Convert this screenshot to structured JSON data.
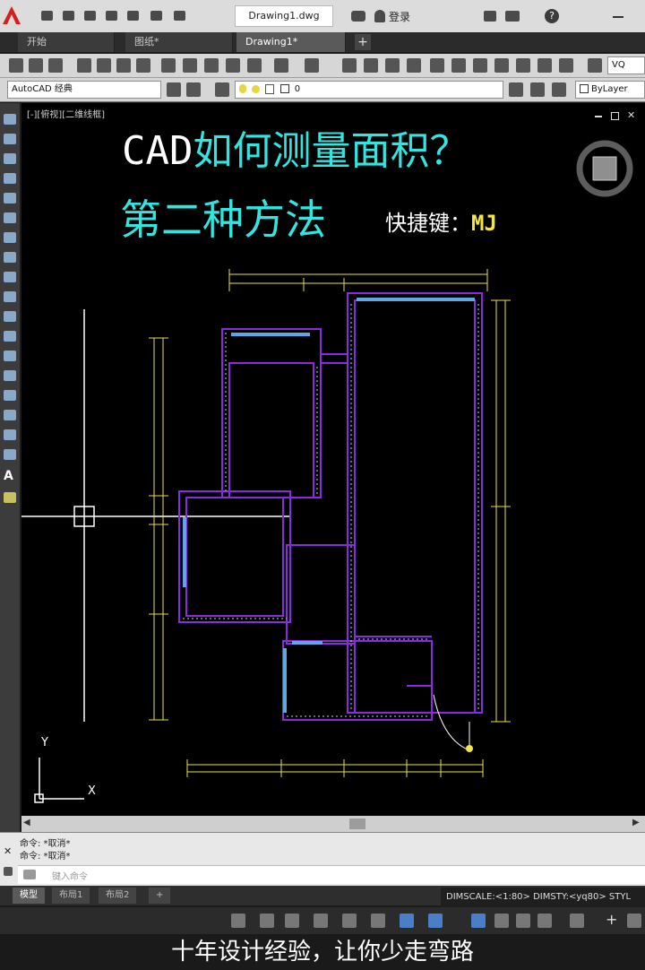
{
  "app": {
    "doc_title": "Drawing1.dwg",
    "login_label": "登录",
    "tabs": [
      {
        "label": "开始"
      },
      {
        "label": "图纸*"
      },
      {
        "label": "Drawing1*"
      }
    ],
    "workspace": "AutoCAD 经典",
    "layer_value": "0",
    "bylayer_label": "ByLayer",
    "search_text": "VQ"
  },
  "viewport": {
    "label": "[-][俯视][二维线框]",
    "ucs_y": "Y",
    "ucs_x": "X"
  },
  "overlay": {
    "line1_prefix": "CAD",
    "line1_rest": "如何测量面积？",
    "line2": "第二种方法",
    "shortcut_label": "快捷键：",
    "shortcut_key": "MJ"
  },
  "command": {
    "lines": [
      "命令: *取消*",
      "命令: *取消*"
    ],
    "placeholder": "键入命令"
  },
  "layouts": {
    "tabs": [
      "模型",
      "布局1",
      "布局2"
    ],
    "add": "+"
  },
  "status": {
    "dim_text": "DIMSCALE:<1:80> DIMSTY:<yq80> STYL"
  },
  "caption": "十年设计经验，让你少走弯路",
  "colors": {
    "cyan_text": "#33e5e0",
    "yellow_text": "#f5e642",
    "wall": "#8a2be2",
    "window": "#5aa8e6",
    "dim": "#e8e050"
  }
}
